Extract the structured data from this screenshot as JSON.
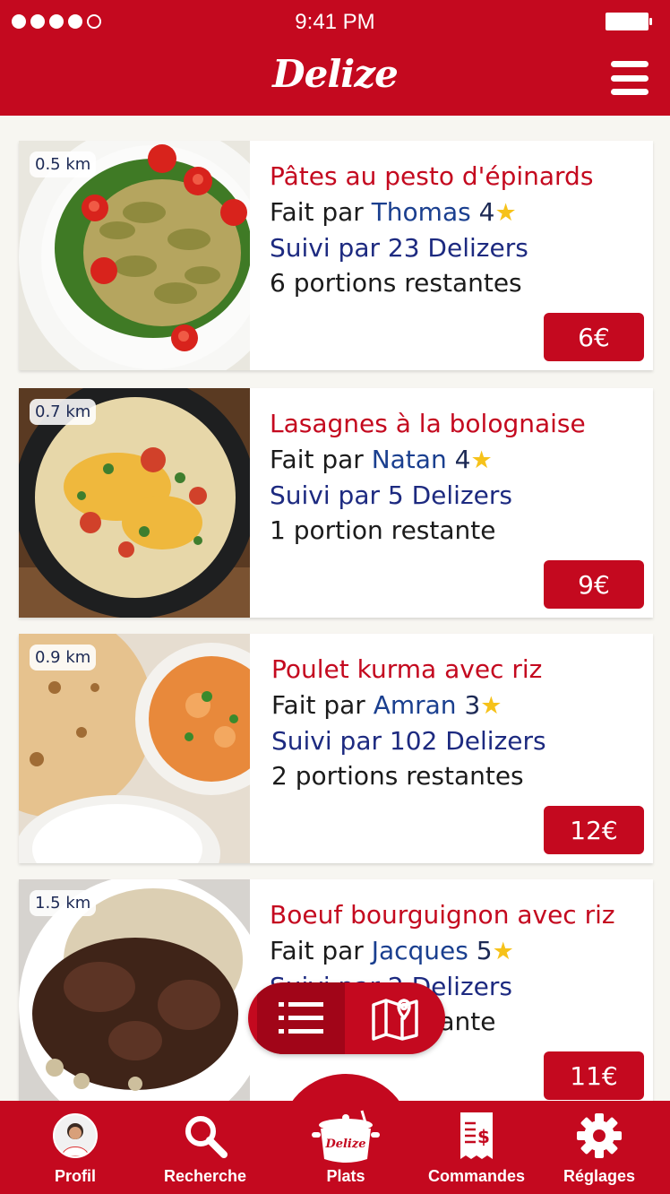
{
  "status_bar": {
    "time": "9:41 PM"
  },
  "header": {
    "logo": "Delize"
  },
  "dishes": [
    {
      "distance": "0.5 km",
      "title": "Pâtes au pesto d'épinards",
      "made_by": "Fait par",
      "cook": "Thomas",
      "rating": "4",
      "followers": "Suivi par 23 Delizers",
      "portions": "6 portions restantes",
      "price": "6€"
    },
    {
      "distance": "0.7 km",
      "title": "Lasagnes à la bolognaise",
      "made_by": "Fait par",
      "cook": "Natan",
      "rating": "4",
      "followers": "Suivi par 5 Delizers",
      "portions": "1 portion restante",
      "price": "9€"
    },
    {
      "distance": "0.9 km",
      "title": "Poulet kurma avec riz",
      "made_by": "Fait par",
      "cook": "Amran",
      "rating": "3",
      "followers": "Suivi par 102 Delizers",
      "portions": "2 portions restantes",
      "price": "12€"
    },
    {
      "distance": "1.5 km",
      "title": "Boeuf bourguignon avec riz",
      "made_by": "Fait par",
      "cook": "Jacques",
      "rating": "5",
      "followers": "Suivi par 2 Delizers",
      "portions": "1 portion restante",
      "price": "11€"
    }
  ],
  "nav": {
    "profile": "Profil",
    "search": "Recherche",
    "dishes": "Plats",
    "dishes_logo": "Delize",
    "orders": "Commandes",
    "settings": "Réglages"
  },
  "colors": {
    "brand": "#c4091f",
    "cook_name": "#1a3f8f",
    "star": "#f6c21a"
  },
  "icons": [
    "hamburger-menu-icon",
    "star-icon",
    "list-icon",
    "map-icon",
    "search-icon",
    "cooking-pot-icon",
    "receipt-icon",
    "gear-icon"
  ]
}
